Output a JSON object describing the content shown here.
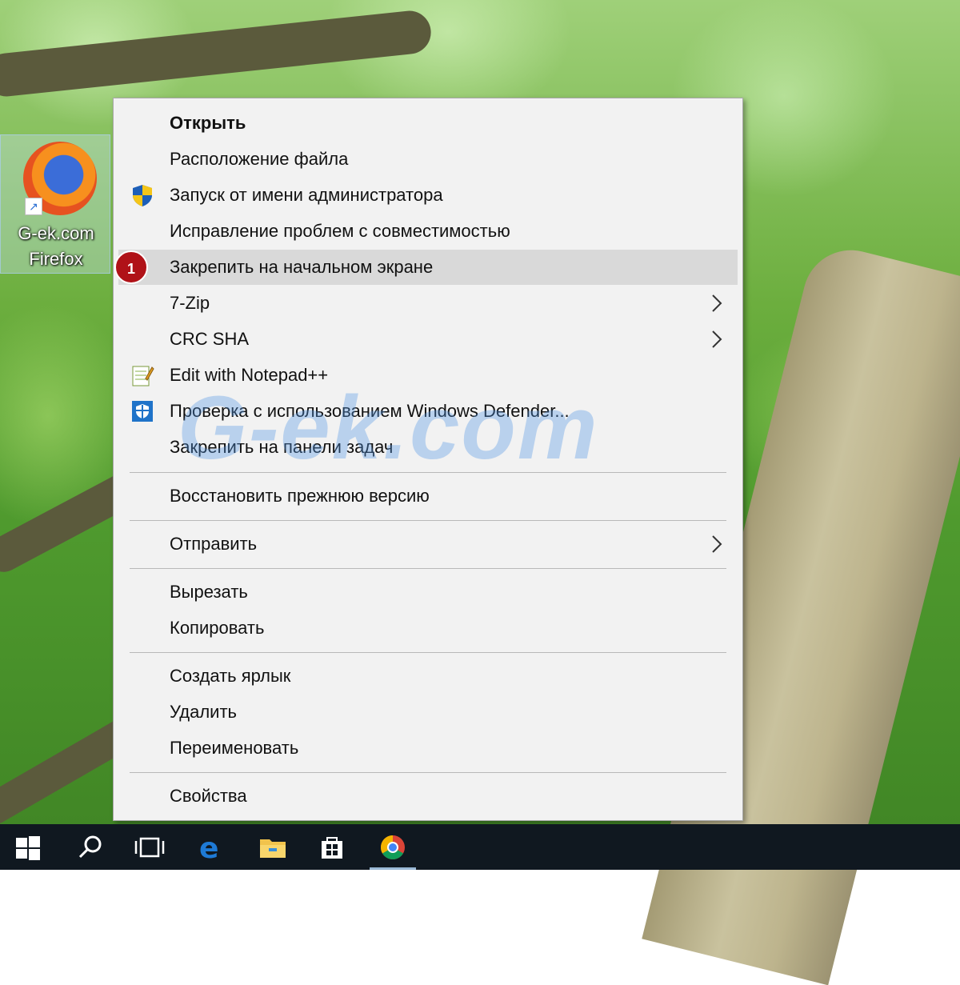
{
  "desktop": {
    "icon": {
      "name": "firefox-shortcut",
      "label_line1": "G-ek.com",
      "label_line2": "Firefox"
    }
  },
  "context_menu": {
    "items": [
      {
        "label": "Открыть",
        "bold": true
      },
      {
        "label": "Расположение файла"
      },
      {
        "label": "Запуск от имени администратора",
        "icon": "uac-shield-icon"
      },
      {
        "label": "Исправление проблем с совместимостью"
      },
      {
        "label": "Закрепить на начальном экране",
        "highlighted": true
      },
      {
        "label": "7-Zip",
        "submenu": true
      },
      {
        "label": "CRC SHA",
        "submenu": true
      },
      {
        "label": "Edit with Notepad++",
        "icon": "notepad-plus-plus-icon"
      },
      {
        "label": "Проверка с использованием Windows Defender...",
        "icon": "windows-defender-icon"
      },
      {
        "label": "Закрепить на панели задач"
      },
      {
        "label": "Восстановить прежнюю версию"
      },
      {
        "label": "Отправить",
        "submenu": true
      },
      {
        "label": "Вырезать"
      },
      {
        "label": "Копировать"
      },
      {
        "label": "Создать ярлык"
      },
      {
        "label": "Удалить"
      },
      {
        "label": "Переименовать"
      },
      {
        "label": "Свойства"
      }
    ]
  },
  "annotation": {
    "badge": "1"
  },
  "watermark": "G-ek.com",
  "taskbar": {
    "buttons": [
      "start-icon",
      "search-icon",
      "task-view-icon",
      "edge-icon",
      "file-explorer-icon",
      "store-icon",
      "chrome-icon"
    ]
  },
  "colors": {
    "menu_bg": "#f2f2f2",
    "highlight": "#d9d9d9",
    "badge": "#b01218",
    "taskbar": "#101820"
  }
}
